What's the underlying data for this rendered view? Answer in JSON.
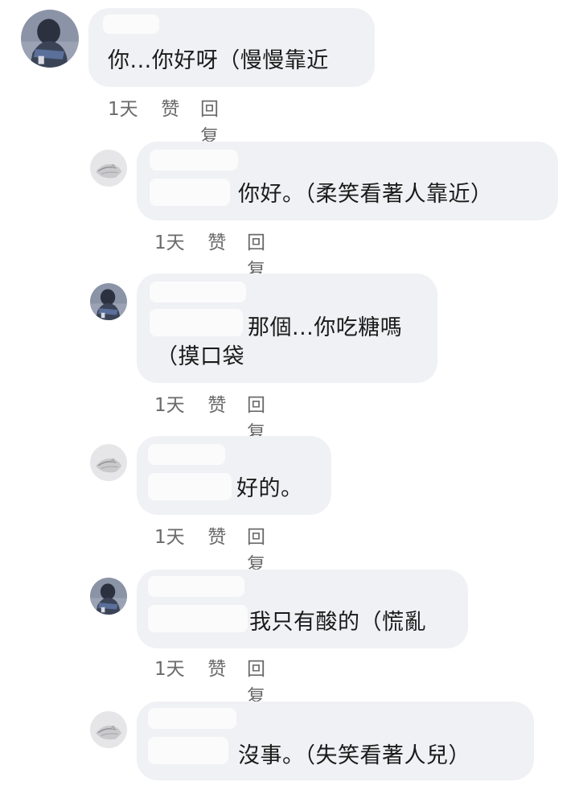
{
  "comments": [
    {
      "level": "top",
      "avatar": "sitting-person-avatar",
      "text": "你...你好呀（慢慢靠近",
      "time": "1天",
      "like": "赞",
      "reply": "回复"
    },
    {
      "level": "reply",
      "avatar": "hand-sketch-avatar",
      "text": "你好。（柔笑看著人靠近）",
      "time": "1天",
      "like": "赞",
      "reply": "回复"
    },
    {
      "level": "reply",
      "avatar": "sitting-person-avatar",
      "text_line1": "那個...你吃糖嗎",
      "text_line2": "（摸口袋",
      "time": "1天",
      "like": "赞",
      "reply": "回复"
    },
    {
      "level": "reply",
      "avatar": "hand-sketch-avatar",
      "text": "好的。",
      "time": "1天",
      "like": "赞",
      "reply": "回复"
    },
    {
      "level": "reply",
      "avatar": "sitting-person-avatar",
      "text": "我只有酸的（慌亂",
      "time": "1天",
      "like": "赞",
      "reply": "回复"
    },
    {
      "level": "reply",
      "avatar": "hand-sketch-avatar",
      "text": "沒事。（失笑看著人兒）",
      "time": "",
      "like": "",
      "reply": ""
    }
  ]
}
